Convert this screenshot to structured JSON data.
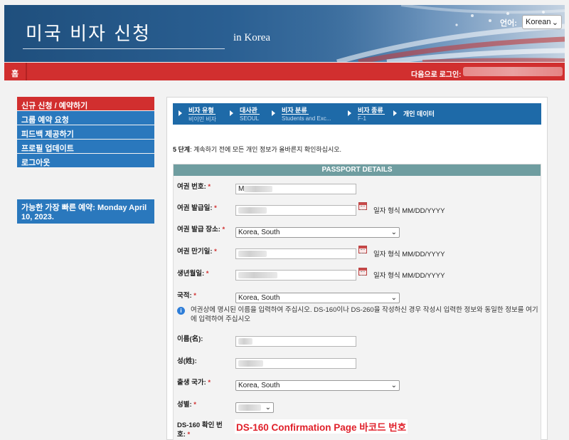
{
  "header": {
    "title": "미국 비자 신청",
    "subtitle": "in Korea",
    "language_label": "언어:",
    "language_value": "Korean"
  },
  "topbar": {
    "home": "홈",
    "login_label": "다음으로 로그인:"
  },
  "sidebar": {
    "items": [
      {
        "label": "신규 신청 / 예약하기",
        "active": true
      },
      {
        "label": "그룹 예약 요청"
      },
      {
        "label": "피드백 제공하기"
      },
      {
        "label": "프로필 업데이트"
      },
      {
        "label": "로그아웃"
      }
    ],
    "soonest": "가능한 가장 빠른 예약: Monday April 10, 2023."
  },
  "steps": [
    {
      "title": "비자 유형",
      "sub": "비이민 비자"
    },
    {
      "title": "대사관",
      "sub": "SEOUL"
    },
    {
      "title": "비자 분류",
      "sub": "Students and Exc..."
    },
    {
      "title": "비자 종류",
      "sub": "F-1"
    },
    {
      "title": "개인 데이터",
      "sub": ""
    }
  ],
  "instruction": {
    "step": "5 단계",
    "text": ": 계속하기 전에 모든 개인 정보가 올바른지 확인하십시오."
  },
  "form": {
    "section_title": "PASSPORT DETAILS",
    "passport_number_label": "여권 번호:",
    "passport_number_value": "M",
    "issue_date_label": "여권 발급일:",
    "issue_place_label": "여권 발급 장소:",
    "issue_place_value": "Korea, South",
    "expiry_label": "여권 만기일:",
    "dob_label": "생년월일:",
    "date_format": "일자 형식 MM/DD/YYYY",
    "nationality_label": "국적:",
    "nationality_value": "Korea, South",
    "info_text": "여권상에 명시된 이름을 입력하여 주십시오. DS-160이나 DS-260을 작성하신 경우 작성시 입력한 정보와 동일한 정보를 여기에 입력하여 주십시오",
    "given_name_label": "이름(名):",
    "surname_label": "성(姓):",
    "birth_country_label": "출생 국가:",
    "birth_country_value": "Korea, South",
    "gender_label": "성별:",
    "ds160_label": "DS-160 확인 번호:",
    "ds160_note": "DS-160 Confirmation Page 바코드 번호",
    "required_mark": "*"
  },
  "colors": {
    "red": "#d12f2f",
    "blue": "#2a78bd",
    "teal_header": "#6f9da0"
  }
}
